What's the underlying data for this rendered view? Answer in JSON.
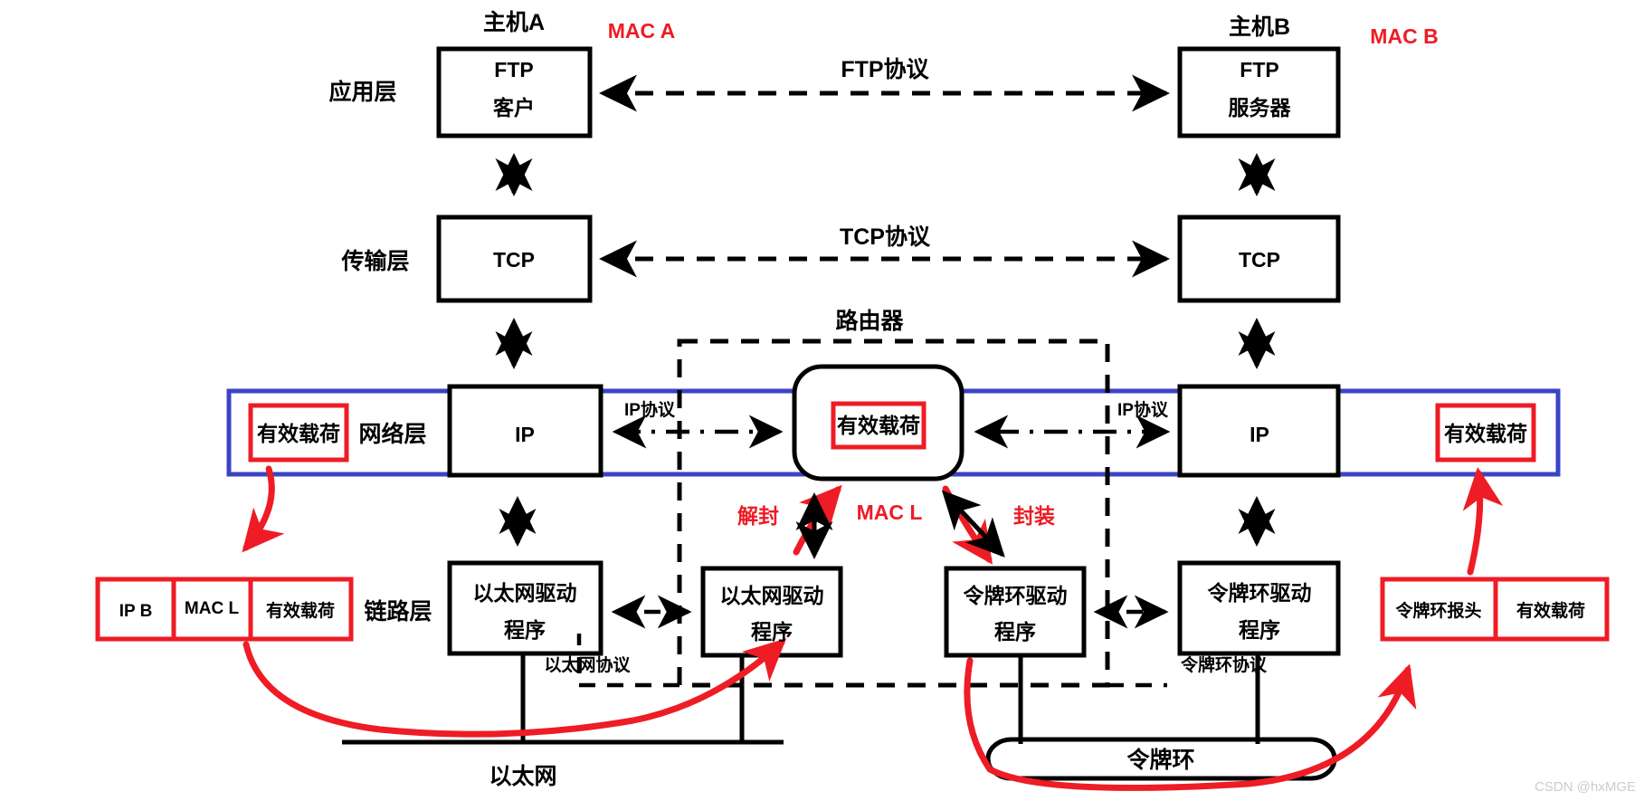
{
  "diagram": {
    "title_hosts": {
      "host_a": "主机A",
      "host_b": "主机B",
      "mac_a": "MAC A",
      "mac_b": "MAC B",
      "router": "路由器"
    },
    "layer_labels": {
      "application": "应用层",
      "transport": "传输层",
      "network": "网络层",
      "link": "链路层"
    },
    "host_a_stack": {
      "app_line1": "FTP",
      "app_line2": "客户",
      "transport": "TCP",
      "network": "IP",
      "link_line1": "以太网驱动",
      "link_line2": "程序"
    },
    "host_b_stack": {
      "app_line1": "FTP",
      "app_line2": "服务器",
      "transport": "TCP",
      "network": "IP",
      "link_line1": "令牌环驱动",
      "link_line2": "程序"
    },
    "router_stack": {
      "payload": "有效载荷",
      "left_link_line1": "以太网驱动",
      "left_link_line2": "程序",
      "right_link_line1": "令牌环驱动",
      "right_link_line2": "程序"
    },
    "protocols": {
      "ftp": "FTP协议",
      "tcp": "TCP协议",
      "ip_left": "IP协议",
      "ip_right": "IP协议",
      "ethernet": "以太网协议",
      "tokenring": "令牌环协议"
    },
    "media": {
      "ethernet": "以太网",
      "tokenring": "令牌环"
    },
    "annotations": {
      "payload_left": "有效载荷",
      "payload_right": "有效载荷",
      "decapsulate": "解封",
      "encapsulate": "封装",
      "mac_l": "MAC L"
    },
    "frame_left": {
      "cells": [
        "IP B",
        "MAC L",
        "有效载荷"
      ]
    },
    "frame_right": {
      "cells": [
        "令牌环报头",
        "有效载荷"
      ]
    },
    "watermark": "CSDN @hxMGE",
    "colors": {
      "accent_red": "#ee1c25",
      "accent_blue": "#3b44c4",
      "outline": "#000000",
      "background": "#ffffff"
    }
  }
}
